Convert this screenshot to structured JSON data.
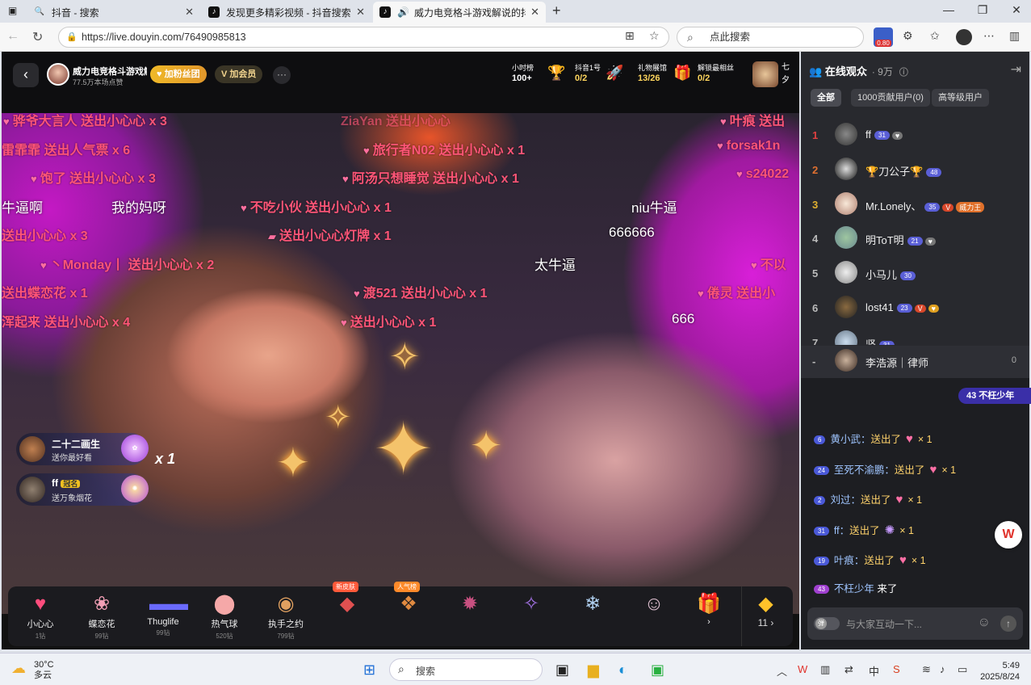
{
  "browser": {
    "tabs": [
      {
        "label": "抖音 - 搜索",
        "icon": "search-icon"
      },
      {
        "label": "发现更多精彩视频 - 抖音搜索",
        "icon": "douyin-icon"
      },
      {
        "label": "威力电竞格斗游戏解说的抖音",
        "icon": "douyin-icon",
        "active": true
      }
    ],
    "url": "https://live.douyin.com/76490985813",
    "search_placeholder": "点此搜索",
    "badge": "0.80"
  },
  "stream": {
    "name": "威力电竞格斗游戏解",
    "likes": "77.5万本场点赞",
    "fan_btn": "加粉丝团",
    "member_btn": "加会员",
    "stats": [
      {
        "label": "小时榜",
        "value": "100+"
      },
      {
        "label": "抖音1号",
        "value": "0/2"
      },
      {
        "label": "礼物展馆",
        "value": "13/26"
      },
      {
        "label": "解锁最相丝",
        "value": "0/2"
      }
    ],
    "side_label": "七夕"
  },
  "danmaku": [
    "骅爷大言人 送出小心心 x 3",
    "雷霏霏 送出人气票 x 6",
    "饱了 送出小心心 x 3",
    "送出小心心 x 3",
    "丶Monday丨 送出小心心 x 2",
    "送出蝶恋花 x 1",
    "浑起来 送出小心心 x 4",
    "旅行者N02 送出小心心 x 1",
    "阿汤只想睡觉 送出小心心 x 1",
    "不吃小伙 送出小心心 x 1",
    "送出小心心灯牌 x 1",
    "渡521 送出小心心 x 1",
    "送出小心心 x 1",
    "叶痕 送出",
    "forsak1n",
    "s24022",
    "不以",
    "倦灵 送出小",
    "ZiaYan 送出小心心"
  ],
  "danmaku_white": [
    "牛逼啊",
    "我的妈呀",
    "niu牛逼",
    "666666",
    "太牛逼",
    "666"
  ],
  "gift_banners": [
    {
      "name": "二十二画生",
      "text": "送你最好看"
    },
    {
      "name": "ff",
      "badge": "冠名",
      "text": "送万象烟花"
    }
  ],
  "gift_count": "x 1",
  "gifts": [
    {
      "name": "小心心",
      "price": "1钻",
      "icon": "heart-icon"
    },
    {
      "name": "蝶恋花",
      "price": "99钻",
      "icon": "flower-icon"
    },
    {
      "name": "Thuglife",
      "price": "99钻",
      "icon": "sunglasses-icon"
    },
    {
      "name": "热气球",
      "price": "520钻",
      "icon": "balloon-icon"
    },
    {
      "name": "执手之约",
      "price": "799钻",
      "icon": "ring-icon"
    },
    {
      "name": "",
      "price": "",
      "icon": "gift-icon",
      "tag": "新皮肤"
    },
    {
      "name": "",
      "price": "",
      "icon": "gift-icon",
      "tag": "人气榜"
    },
    {
      "name": "",
      "price": "",
      "icon": "gift-icon"
    },
    {
      "name": "",
      "price": "",
      "icon": "gift-icon"
    },
    {
      "name": "",
      "price": "",
      "icon": "gift-icon"
    },
    {
      "name": "",
      "price": "",
      "icon": "gift-icon"
    }
  ],
  "diamond": {
    "count": "11"
  },
  "audience": {
    "title": "在线观众",
    "count": "· 9万",
    "tabs": [
      "全部",
      "1000贡献用户(0)",
      "高等级用户"
    ],
    "users": [
      {
        "rank": "1",
        "name": "ff",
        "level": "31",
        "color": "#e04040"
      },
      {
        "rank": "2",
        "name": "🏆刀公子🏆",
        "level": "48",
        "color": "#e07030"
      },
      {
        "rank": "3",
        "name": "Mr.Lonely、",
        "level": "35",
        "color": "#e0b030"
      },
      {
        "rank": "4",
        "name": "明ToT明",
        "level": "21",
        "color": "#aaa"
      },
      {
        "rank": "5",
        "name": "小马儿",
        "level": "30",
        "color": "#aaa"
      },
      {
        "rank": "6",
        "name": "lost41",
        "level": "23",
        "color": "#aaa"
      },
      {
        "rank": "7",
        "name": "坚",
        "level": "31",
        "color": "#aaa"
      }
    ],
    "me": {
      "rank": "-",
      "name": "李浩源｜律师",
      "score": "0"
    }
  },
  "chat": {
    "entry_banner": "43 不枉少年",
    "messages": [
      {
        "level": "6",
        "name": "黄小武：",
        "action": "送出了",
        "count": "× 1"
      },
      {
        "level": "24",
        "name": "至死不渝鹏：",
        "action": "送出了",
        "count": "× 1"
      },
      {
        "level": "2",
        "name": "刘过：",
        "action": "送出了",
        "count": "× 1"
      },
      {
        "level": "31",
        "name": "ff：",
        "action": "送出了",
        "count": "× 1"
      },
      {
        "level": "19",
        "name": "叶痕：",
        "action": "送出了",
        "count": "× 1"
      },
      {
        "level": "43",
        "name": "不枉少年",
        "action": "来了",
        "count": ""
      }
    ],
    "input_placeholder": "与大家互动一下..."
  },
  "taskbar": {
    "temp": "30°C",
    "weather": "多云",
    "search": "搜索",
    "time": "5:49",
    "date": "2025/8/24"
  }
}
